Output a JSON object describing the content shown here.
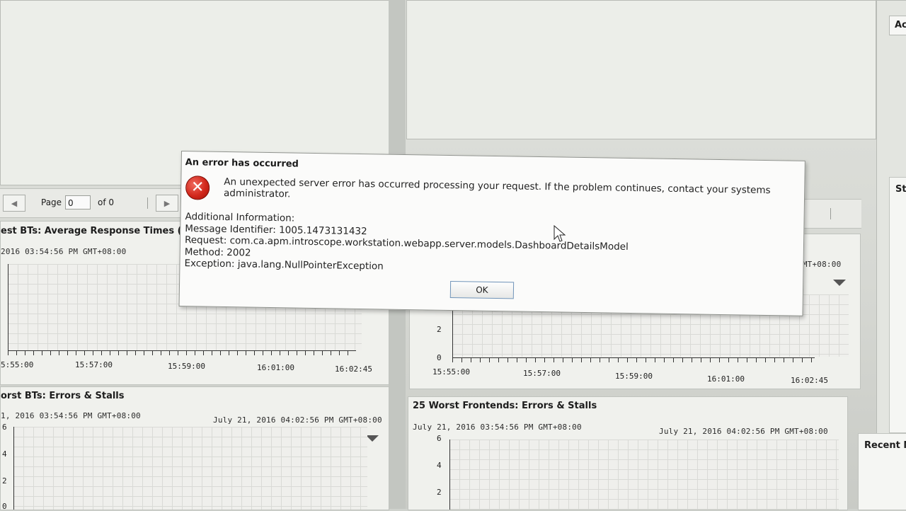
{
  "pager": {
    "page_label": "Page",
    "page_value": "0",
    "of_label": "of 0"
  },
  "panels": {
    "top_left": {
      "title": "est BTs: Average Response Times (ms)",
      "range_start": "2016 03:54:56 PM GMT+08:00",
      "x_ticks": [
        "5:55:00",
        "15:57:00",
        "15:59:00",
        "16:01:00",
        "16:02:45"
      ]
    },
    "top_right": {
      "range_end_fragment": "GMT+08:00",
      "y_ticks": [
        "2",
        "0"
      ],
      "x_ticks": [
        "15:55:00",
        "15:57:00",
        "15:59:00",
        "16:01:00",
        "16:02:45"
      ]
    },
    "bottom_left": {
      "title": "orst BTs: Errors & Stalls",
      "range_start": "1, 2016 03:54:56 PM GMT+08:00",
      "range_end": "July 21, 2016 04:02:56 PM GMT+08:00",
      "y_ticks": [
        "6",
        "4",
        "2",
        "0"
      ]
    },
    "bottom_right": {
      "title": "25 Worst Frontends: Errors & Stalls",
      "range_start": "July 21, 2016 03:54:56 PM GMT+08:00",
      "range_end": "July 21, 2016 04:02:56 PM GMT+08:00",
      "y_ticks": [
        "6",
        "4",
        "2"
      ]
    }
  },
  "right_column": {
    "top_label": "Ac",
    "mid_label": "St",
    "bottom_label": "Recent N"
  },
  "dialog": {
    "title": "An error has occurred",
    "icon": "error-x-icon",
    "message": "An unexpected server error has occurred processing your request. If the problem continues, contact your systems administrator.",
    "info_header": "Additional Information:",
    "message_identifier": "Message Identifier: 1005.1473131432",
    "request": "Request: com.ca.apm.introscope.workstation.webapp.server.models.DashboardDetailsModel",
    "method": "Method: 2002",
    "exception": "Exception: java.lang.NullPointerException",
    "ok_label": "OK"
  },
  "colors": {
    "error_red": "#d2281c",
    "ok_border": "#6f93b8"
  }
}
